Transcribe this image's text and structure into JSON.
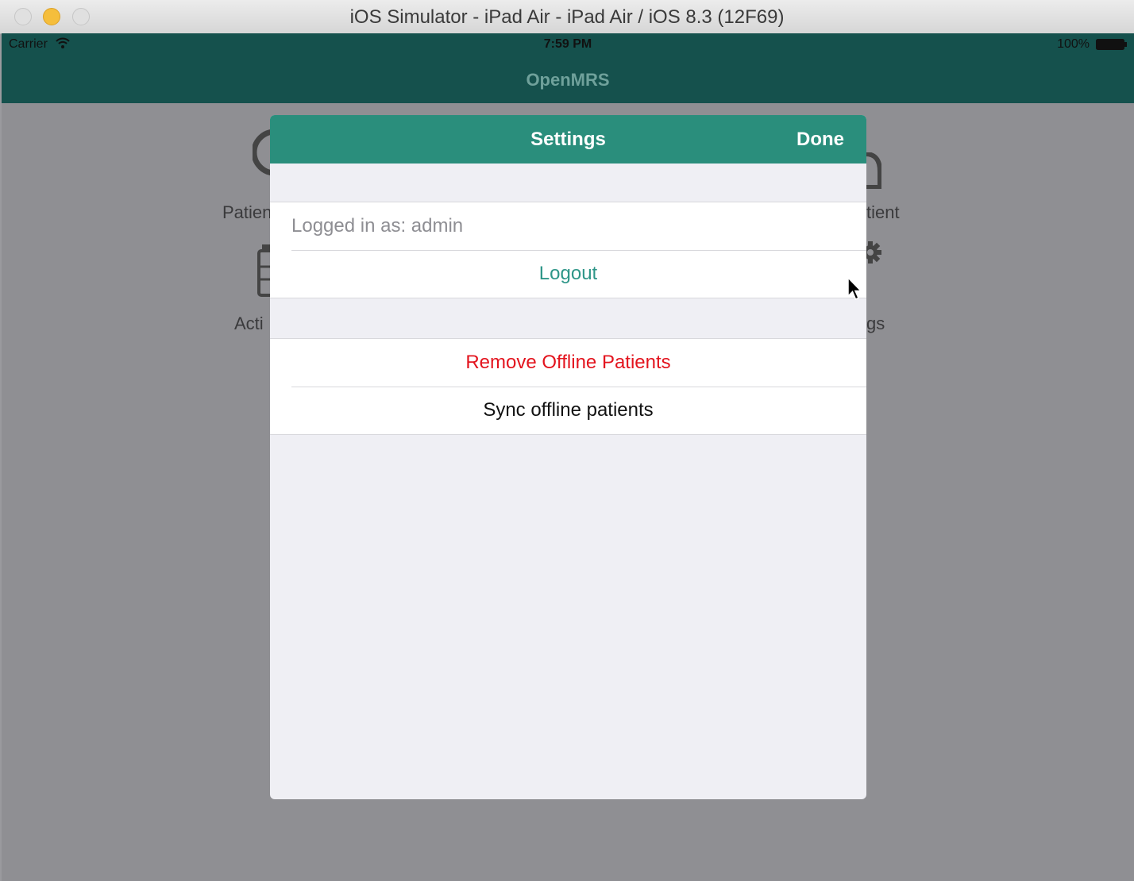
{
  "window": {
    "title": "iOS Simulator - iPad Air - iPad Air / iOS 8.3 (12F69)"
  },
  "statusbar": {
    "carrier": "Carrier",
    "time": "7:59 PM",
    "battery": "100%"
  },
  "navbar": {
    "title": "OpenMRS"
  },
  "background": {
    "tiles": [
      {
        "label_left": "Patien",
        "label_right": "tient"
      },
      {
        "label_left": "Acti",
        "label_right": "gs"
      }
    ]
  },
  "settings": {
    "title": "Settings",
    "done_label": "Done",
    "logged_in": "Logged in as: admin",
    "logout_label": "Logout",
    "remove_offline_label": "Remove Offline Patients",
    "sync_offline_label": "Sync offline patients"
  },
  "colors": {
    "nav_bar": "#15514d",
    "modal_header": "#2a8e7c",
    "accent_teal": "#2e9688",
    "destructive_red": "#e3141e"
  }
}
